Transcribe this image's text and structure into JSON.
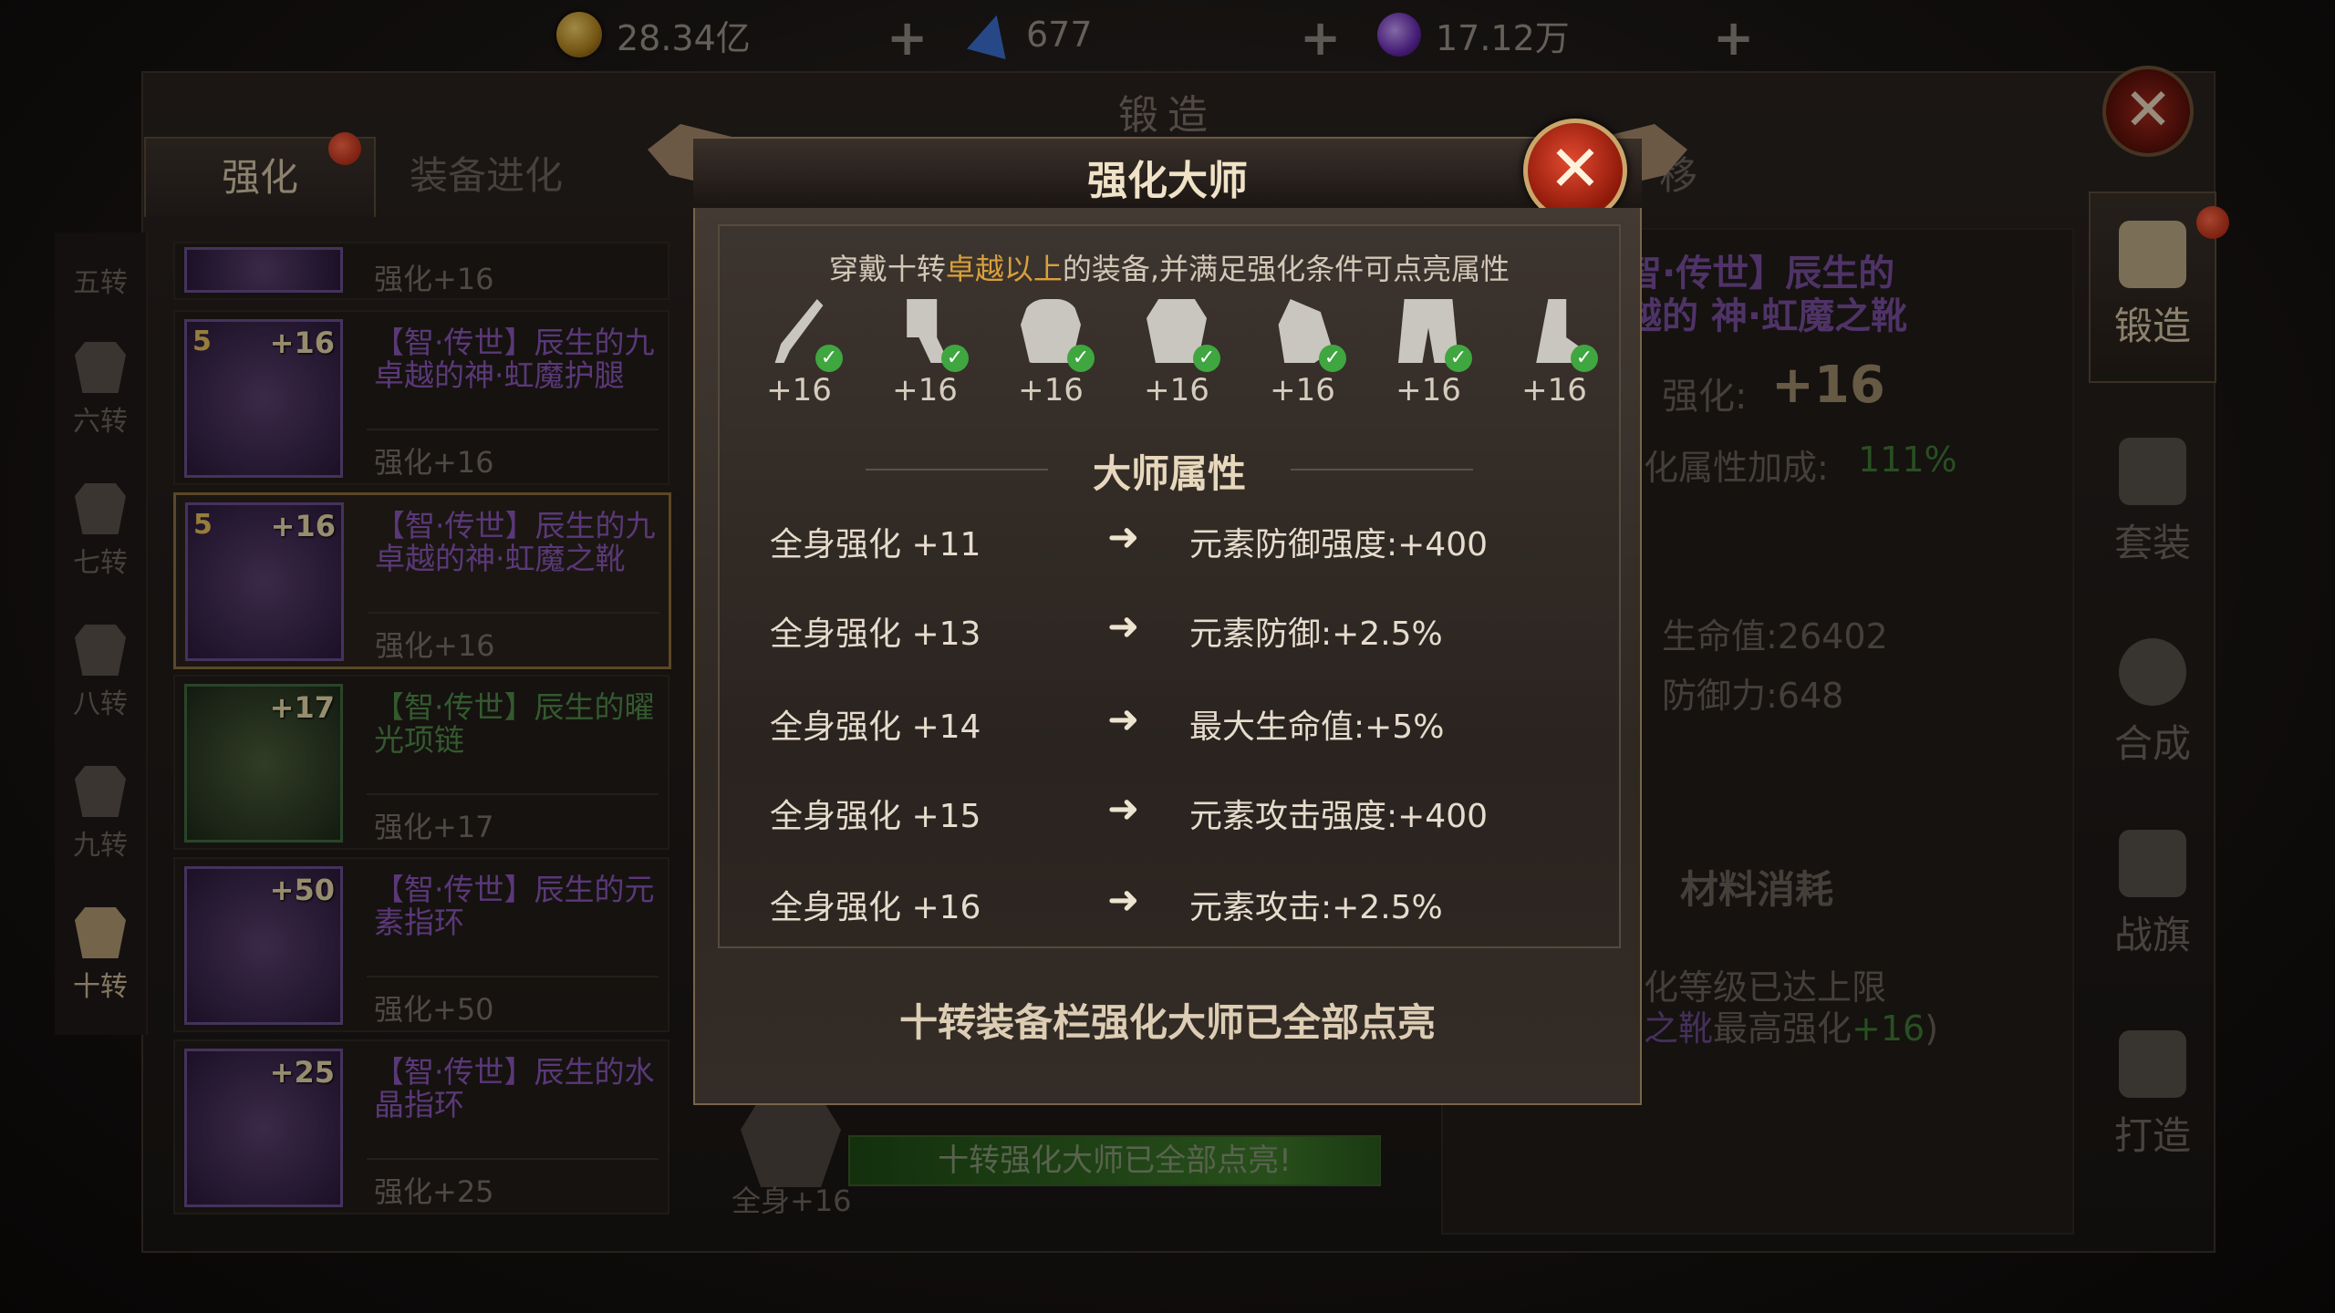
{
  "currency": {
    "gold": "28.34亿",
    "diamond": "677",
    "crystal": "17.12万",
    "plus": "+"
  },
  "window": {
    "title": "锻造",
    "close": "✕",
    "tabs": [
      {
        "label": "强化"
      },
      {
        "label": "装备进化"
      },
      {
        "label": "移"
      }
    ]
  },
  "ranks": [
    "五转",
    "六转",
    "七转",
    "八转",
    "九转",
    "十转"
  ],
  "items": [
    {
      "name": "",
      "level": "强化+16",
      "badge": ""
    },
    {
      "name": "【智·传世】辰生的九卓越的神·虹魔护腿",
      "level": "强化+16",
      "badge": "+16",
      "star": "5"
    },
    {
      "name": "【智·传世】辰生的九卓越的神·虹魔之靴",
      "level": "强化+16",
      "badge": "+16",
      "star": "5"
    },
    {
      "name": "【智·传世】辰生的曜光项链",
      "level": "强化+17",
      "badge": "+17"
    },
    {
      "name": "【智·传世】辰生的元素指环",
      "level": "强化+50",
      "badge": "+50"
    },
    {
      "name": "【智·传世】辰生的水晶指环",
      "level": "强化+25",
      "badge": "+25"
    }
  ],
  "right_nav": [
    "锻造",
    "套装",
    "合成",
    "战旗",
    "打造"
  ],
  "detail": {
    "name": "【智·传世】辰生的九卓越的神·虹魔之靴",
    "name_line1": "智·传世】辰生的",
    "name_line2": "越的 神·虹魔之靴",
    "enhance_label": "强化:",
    "enhance_value": "+16",
    "bonus_label": "化属性加成:",
    "bonus_value": "111%",
    "hp": "生命值:26402",
    "def": "防御力:648",
    "materials": "材料消耗",
    "limit1": "化等级已达上限",
    "limit2_item": "之靴",
    "limit2_text": "最高强化",
    "limit2_val": "+16",
    "limit2_end": ")"
  },
  "bottom": {
    "progress_text": "十转强化大师已全部点亮!",
    "label": "全身+16"
  },
  "modal": {
    "title": "强化大师",
    "close": "✕",
    "note_pre": "穿戴十转",
    "note_hl": "卓越以上",
    "note_post": "的装备,并满足强化条件可点亮属性",
    "equip_levels": [
      "+16",
      "+16",
      "+16",
      "+16",
      "+16",
      "+16",
      "+16"
    ],
    "subtitle": "大师属性",
    "arrow": "➜",
    "rows": [
      {
        "req": "全身强化 +11",
        "bonus": "元素防御强度:+400"
      },
      {
        "req": "全身强化 +13",
        "bonus": "元素防御:+2.5%"
      },
      {
        "req": "全身强化 +14",
        "bonus": "最大生命值:+5%"
      },
      {
        "req": "全身强化 +15",
        "bonus": "元素攻击强度:+400"
      },
      {
        "req": "全身强化 +16",
        "bonus": "元素攻击:+2.5%"
      }
    ],
    "footer": "十转装备栏强化大师已全部点亮"
  },
  "colors": {
    "accent_gold": "#d9a03c",
    "purple_item": "#8a56b8",
    "green_item": "#4f8a48",
    "check_green": "#3fa640",
    "close_red": "#c22f18"
  },
  "icons": {
    "gold": "gold-coin-icon",
    "diamond": "diamond-icon",
    "crystal": "purple-crystal-icon",
    "check": "check-icon"
  }
}
